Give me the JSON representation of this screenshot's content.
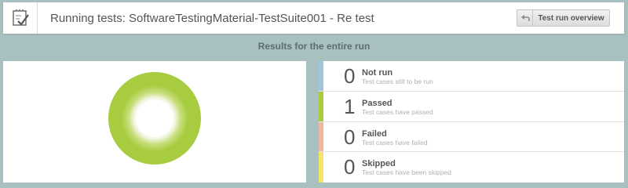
{
  "header": {
    "title": "Running tests: SoftwareTestingMaterial-TestSuite001 - Re test",
    "icon": "checklist-icon",
    "overview_button": {
      "label": "Test run overview",
      "icon": "back-arrow-icon"
    }
  },
  "section_title": "Results for the entire run",
  "results": [
    {
      "label": "Not run",
      "count": "0",
      "description": "Test cases still to be run",
      "color": "#9fc5d9"
    },
    {
      "label": "Passed",
      "count": "1",
      "description": "Test cases have passed",
      "color": "#a8cc3f"
    },
    {
      "label": "Failed",
      "count": "0",
      "description": "Test cases have failed",
      "color": "#f0b6a0"
    },
    {
      "label": "Skipped",
      "count": "0",
      "description": "Test cases have been skipped",
      "color": "#f5e56b"
    }
  ],
  "donut": {
    "passed_fraction": 1.0,
    "color": "#a8cc3f"
  }
}
